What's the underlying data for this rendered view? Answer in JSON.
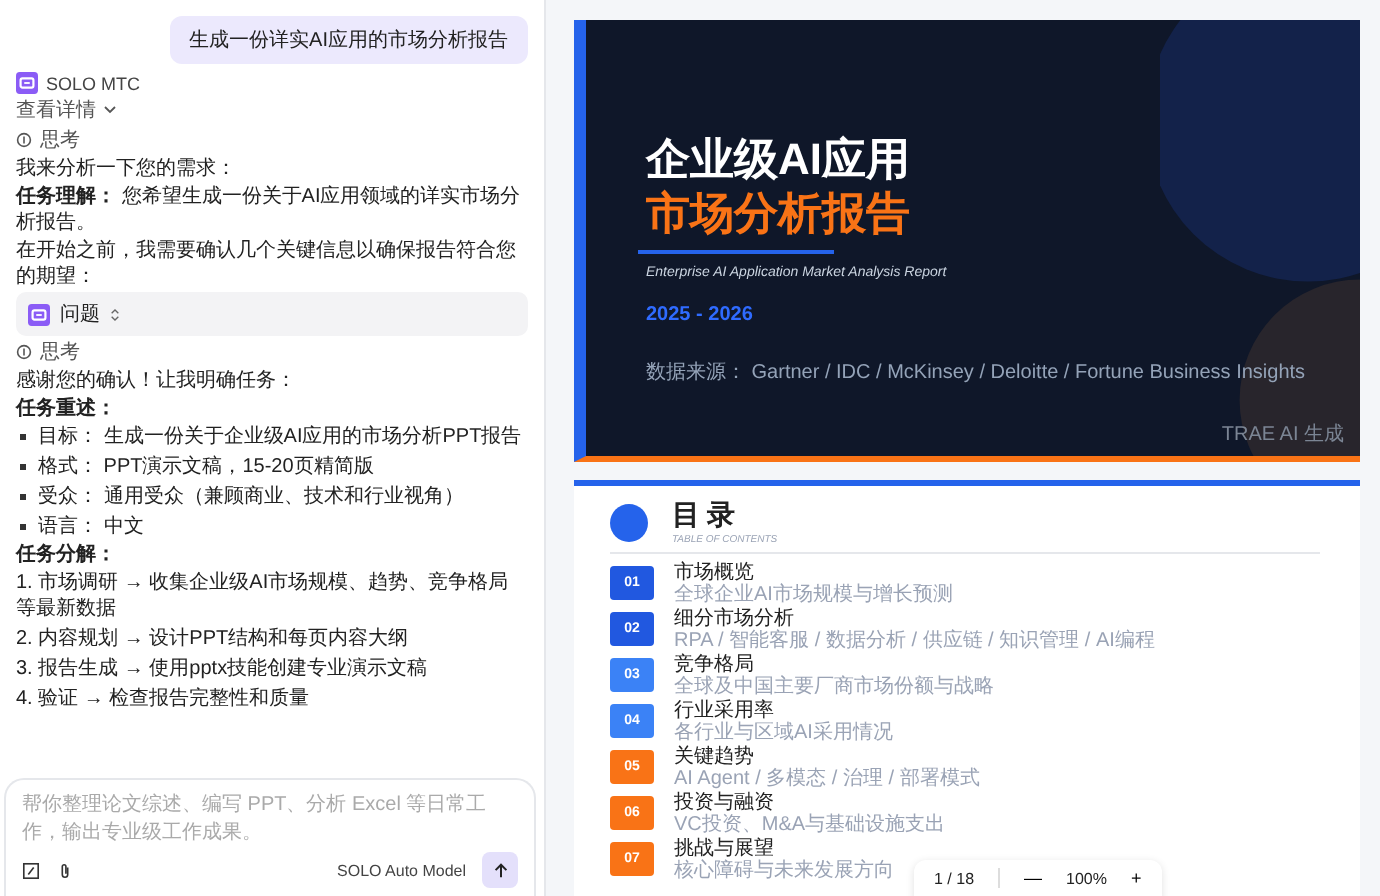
{
  "chat": {
    "user_message": "生成一份详实AI应用的市场分析报告",
    "agent_name": "SOLO MTC",
    "details_label": "查看详情",
    "blocks": [
      {
        "kind": "thinking",
        "text": "思考"
      },
      {
        "kind": "paragraph",
        "text": "我来分析一下您的需求："
      },
      {
        "kind": "paragraph",
        "text": "**任务理解：** 您希望生成一份关于AI应用领域的详实市场分析报告。"
      },
      {
        "kind": "paragraph",
        "text": "在开始之前，我需要确认几个关键信息以确保报告符合您的期望："
      },
      {
        "kind": "question",
        "text": "问题"
      },
      {
        "kind": "thinking",
        "text": "思考"
      },
      {
        "kind": "paragraph",
        "text": "感谢您的确认！让我明确任务："
      },
      {
        "kind": "heading",
        "text": "任务重述："
      },
      {
        "kind": "bullets",
        "items": [
          "目标： 生成一份关于企业级AI应用的市场分析PPT报告",
          "格式： PPT演示文稿，15-20页精简版",
          "受众： 通用受众（兼顾商业、技术和行业视角）",
          "语言： 中文"
        ]
      },
      {
        "kind": "heading",
        "text": "任务分解："
      },
      {
        "kind": "numbered",
        "items": [
          "1. 市场调研 → 收集企业级AI市场规模、趋势、竞争格局等最新数据",
          "2. 内容规划 → 设计PPT结构和每页内容大纲",
          "3. 报告生成 → 使用pptx技能创建专业演示文稿",
          "4. 验证 → 检查报告完整性和质量"
        ]
      }
    ]
  },
  "composer": {
    "placeholder": "帮你整理论文综述、编写 PPT、分析 Excel 等日常工作，输出专业级工作成果。",
    "model": "SOLO Auto Model"
  },
  "cover_slide": {
    "title_line_1": "企业级AI应用",
    "title_line_2": "市场分析报告",
    "subtitle": "Enterprise AI Application Market Analysis Report",
    "years": "2025 - 2026",
    "sources": "数据来源： Gartner / IDC / McKinsey / Deloitte / Fortune Business Insights",
    "credit": "TRAE AI 生成"
  },
  "toc_slide": {
    "title": "目 录",
    "subtitle": "TABLE OF CONTENTS",
    "items": [
      {
        "number": "01",
        "title": "市场概览",
        "description": "全球企业AI市场规模与增长预测",
        "color": "#2158e0"
      },
      {
        "number": "02",
        "title": "细分市场分析",
        "description": "RPA / 智能客服 / 数据分析 / 供应链 / 知识管理 / AI编程",
        "color": "#2158e0"
      },
      {
        "number": "03",
        "title": "竞争格局",
        "description": "全球及中国主要厂商市场份额与战略",
        "color": "#3b82f6"
      },
      {
        "number": "04",
        "title": "行业采用率",
        "description": "各行业与区域AI采用情况",
        "color": "#3b82f6"
      },
      {
        "number": "05",
        "title": "关键趋势",
        "description": "AI Agent / 多模态 / 治理 / 部署模式",
        "color": "#f97316"
      },
      {
        "number": "06",
        "title": "投资与融资",
        "description": "VC投资、M&A与基础设施支出",
        "color": "#f97316"
      },
      {
        "number": "07",
        "title": "挑战与展望",
        "description": "核心障碍与未来发展方向",
        "color": "#f97316"
      }
    ]
  },
  "pager": {
    "page": "1 / 18",
    "zoom_out": "—",
    "zoom": "100%",
    "zoom_in": "+"
  }
}
